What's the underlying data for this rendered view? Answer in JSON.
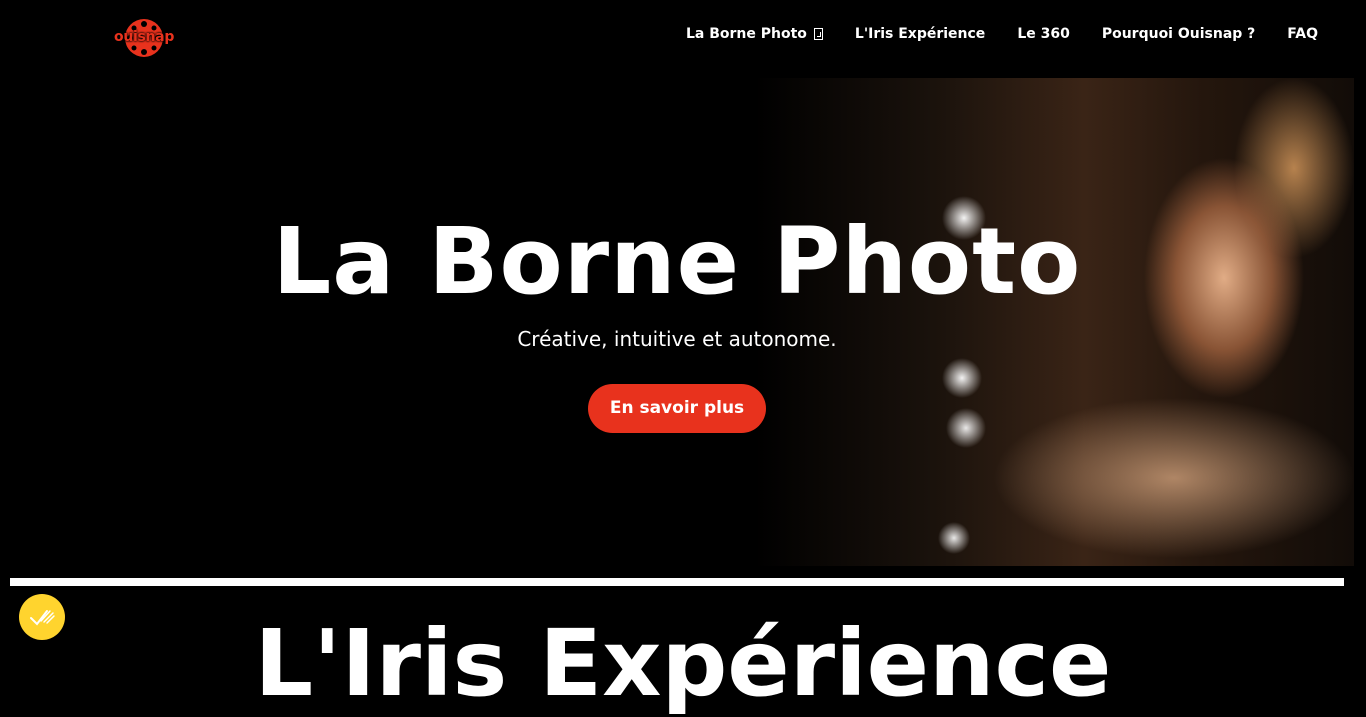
{
  "header": {
    "logo_text": "ouisnap",
    "brand_color": "#e8321d",
    "nav": [
      {
        "label": "La Borne Photo",
        "icon": "dropdown-caret-icon"
      },
      {
        "label": "L'Iris Expérience"
      },
      {
        "label": "Le 360"
      },
      {
        "label": "Pourquoi Ouisnap ?"
      },
      {
        "label": "FAQ"
      }
    ]
  },
  "hero": {
    "title": "La Borne Photo",
    "subtitle": "Créative, intuitive et autonome.",
    "cta_label": "En savoir plus",
    "cta_color": "#e8321d"
  },
  "next_section": {
    "title": "L'Iris Expérience"
  },
  "cookie_badge": {
    "icon": "cookie-consent-icon",
    "color": "#ffd42e"
  }
}
